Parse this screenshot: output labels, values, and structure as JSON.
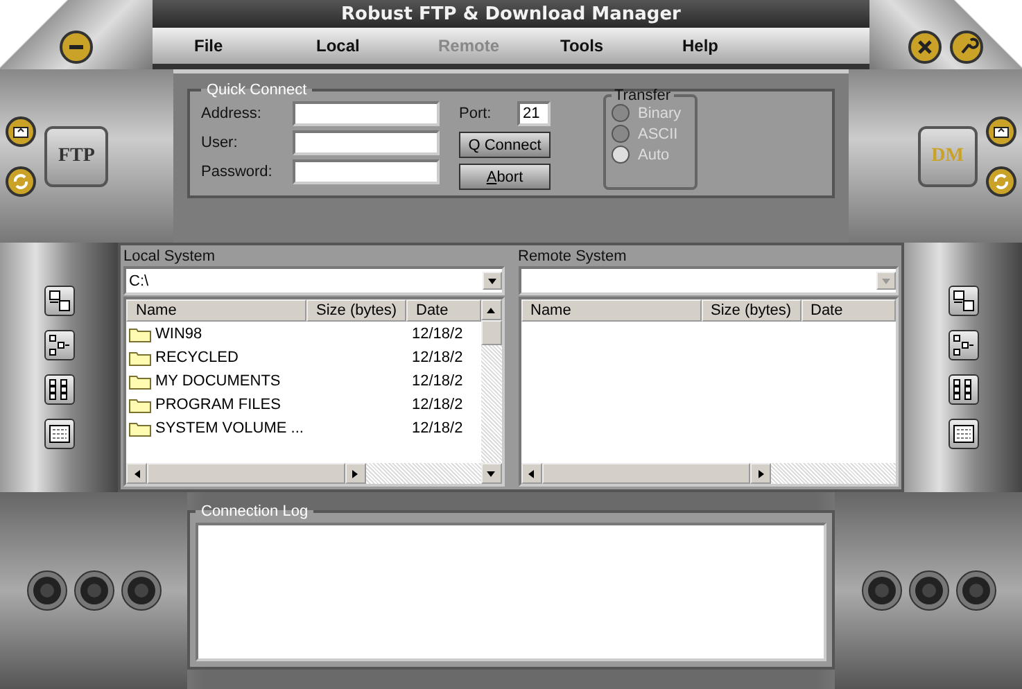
{
  "window": {
    "title": "Robust FTP & Download Manager"
  },
  "menu": [
    {
      "label": "File",
      "disabled": false
    },
    {
      "label": "Local",
      "disabled": false
    },
    {
      "label": "Remote",
      "disabled": true
    },
    {
      "label": "Tools",
      "disabled": false
    },
    {
      "label": "Help",
      "disabled": false
    }
  ],
  "badges": {
    "left": "FTP",
    "right": "DM"
  },
  "quick_connect": {
    "title": "Quick Connect",
    "fields": [
      {
        "label": "Address:"
      },
      {
        "label": "User:"
      },
      {
        "label": "Password:"
      }
    ],
    "port": {
      "label": "Port:",
      "value": "21"
    },
    "buttons": [
      {
        "label": "Q Connect"
      },
      {
        "label": "Abort",
        "underline_first": true
      }
    ]
  },
  "transfer": {
    "title": "Transfer",
    "options": [
      {
        "label": "Binary",
        "selected": false,
        "disabled": true
      },
      {
        "label": "ASCII",
        "selected": false,
        "disabled": true
      },
      {
        "label": "Auto",
        "selected": true,
        "disabled": true
      }
    ]
  },
  "local": {
    "title": "Local System",
    "path": "C:\\",
    "dropdown_disabled": false,
    "columns": [
      "Name",
      "Size (bytes)",
      "Date"
    ],
    "rows": [
      {
        "kind": "folder",
        "name": "WIN98",
        "date": "12/18/2"
      },
      {
        "kind": "folder",
        "name": "RECYCLED",
        "date": "12/18/2"
      },
      {
        "kind": "folder",
        "name": "MY DOCUMENTS",
        "date": "12/18/2"
      },
      {
        "kind": "folder",
        "name": "PROGRAM FILES",
        "date": "12/18/2"
      },
      {
        "kind": "folder",
        "name": "SYSTEM VOLUME ...",
        "date": "12/18/2"
      }
    ]
  },
  "remote": {
    "title": "Remote System",
    "dropdown_disabled": true,
    "columns": [
      "Name",
      "Size (bytes)",
      "Date"
    ]
  },
  "log": {
    "title": "Connection Log"
  }
}
